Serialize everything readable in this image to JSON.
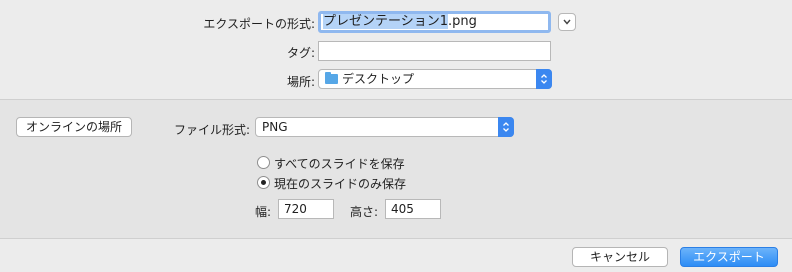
{
  "export": {
    "format_label": "エクスポートの形式:",
    "filename_selected": "プレゼンテーション1",
    "filename_rest": ".png",
    "tags_label": "タグ:",
    "tags_value": "",
    "location_label": "場所:",
    "location_value": "デスクトップ"
  },
  "options": {
    "online_button": "オンラインの場所",
    "file_format_label": "ファイル形式:",
    "file_format_value": "PNG",
    "radio_all": "すべてのスライドを保存",
    "radio_current": "現在のスライドのみ保存",
    "width_label": "幅:",
    "width_value": "720",
    "height_label": "高さ:",
    "height_value": "405"
  },
  "footer": {
    "cancel": "キャンセル",
    "export": "エクスポート"
  },
  "colors": {
    "accent": "#3b87f0",
    "selection": "#b4d3f7",
    "focus_ring": "#8fb8ef"
  },
  "icons": {
    "expand": "chevron-down-icon",
    "popup": "updown-arrows-icon",
    "location": "folder-icon"
  }
}
